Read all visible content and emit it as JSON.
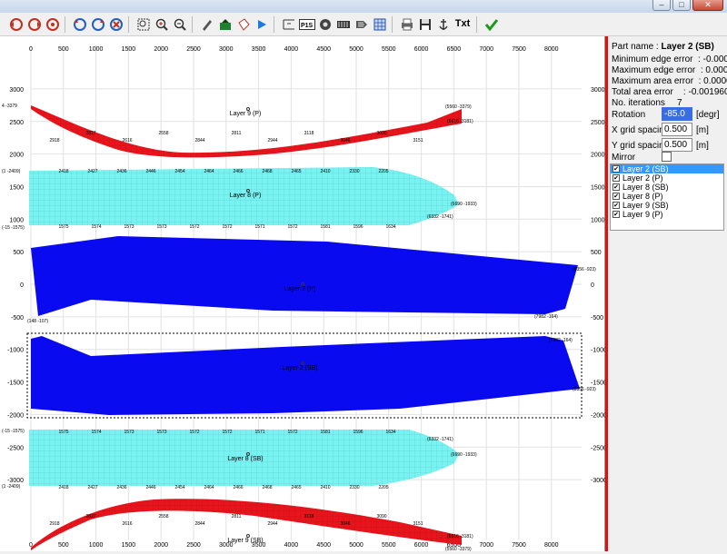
{
  "window": {
    "minimize": "–",
    "maximize": "□",
    "close": "✕"
  },
  "toolbar": {
    "icons": [
      "undo-icon",
      "redo-icon",
      "undo-all-icon",
      "redo-all-icon",
      "rotate-ccw-icon",
      "rotate-cw-icon",
      "rotate-reset-icon",
      "zoom-fit-icon",
      "zoom-in-icon",
      "zoom-out-icon",
      "draw-icon",
      "fill-icon",
      "tag-icon",
      "play-icon",
      "measure-icon",
      "p1s-icon",
      "wheel-icon",
      "film-icon",
      "stack-icon",
      "grid-icon",
      "print-icon",
      "save-icon",
      "anchor-icon",
      "text-icon",
      "ok-icon"
    ],
    "p1s_label": "P1S",
    "txt_label": "Txt"
  },
  "panel": {
    "part_name_label": "Part name",
    "part_name_value": "Layer 2 (SB)",
    "min_edge_label": "Minimum edge error",
    "min_edge_value": "-0.00023",
    "max_edge_label": "Maximum edge error",
    "max_edge_value": "0.00001",
    "max_area_label": "Maximum area error",
    "max_area_value": "0.000056",
    "total_area_label": "Total area error",
    "total_area_value": "-0.001960",
    "iterations_label": "No. iterations",
    "iterations_value": "7",
    "rotation_label": "Rotation",
    "rotation_value": "-85.0",
    "rotation_unit": "[degr]",
    "xgrid_label": "X grid spacing",
    "xgrid_value": "0.500",
    "xgrid_unit": "[m]",
    "ygrid_label": "Y grid spacing",
    "ygrid_value": "0.500",
    "ygrid_unit": "[m]",
    "mirror_label": "Mirror",
    "layers": [
      {
        "label": "Layer 2 (SB)",
        "checked": true,
        "active": true
      },
      {
        "label": "Layer 2 (P)",
        "checked": true,
        "active": false
      },
      {
        "label": "Layer 8 (SB)",
        "checked": true,
        "active": false
      },
      {
        "label": "Layer 8 (P)",
        "checked": true,
        "active": false
      },
      {
        "label": "Layer 9 (SB)",
        "checked": true,
        "active": false
      },
      {
        "label": "Layer 9 (P)",
        "checked": true,
        "active": false
      }
    ]
  },
  "plot": {
    "x_ticks": [
      "0",
      "500",
      "1000",
      "1500",
      "2000",
      "2500",
      "3000",
      "3500",
      "4000",
      "4500",
      "5000",
      "5500",
      "6000",
      "6500",
      "7000",
      "7500",
      "8000"
    ],
    "y_left_ticks": [
      "3000",
      "2500",
      "2000",
      "1500",
      "1000",
      "500",
      "0",
      "-500",
      "-1000",
      "-1500",
      "-2000",
      "-2500",
      "-3000"
    ],
    "y_right_ticks": [
      "3000",
      "2500",
      "2000",
      "1500",
      "1000",
      "500",
      "0",
      "-500",
      "-1000",
      "-1500",
      "-2000",
      "-2500",
      "-3000"
    ],
    "colors": {
      "red": "#e8141c",
      "cyan": "#79f2f2",
      "blue": "#0a0af0"
    },
    "parts": [
      {
        "label": "Layer 9 (P)"
      },
      {
        "label": "Layer 8 (P)"
      },
      {
        "label": "Layer 2 (P)"
      },
      {
        "label": "Layer 2 (SB)"
      },
      {
        "label": "Layer 8 (SB)"
      },
      {
        "label": "Layer 9 (SB)"
      }
    ],
    "top_bounds_labels": [
      "4 -3379",
      "(5560 -3379)",
      "(6616 -3181)",
      "2918",
      "2827",
      "2616",
      "2558",
      "2844",
      "2811",
      "2944",
      "3118",
      "3046",
      "3090",
      "3151"
    ],
    "cyan_labels_top": [
      "2418",
      "2427",
      "2436",
      "2446",
      "2454",
      "2464",
      "2466",
      "2468",
      "2465",
      "2410",
      "2330",
      "2205"
    ],
    "cyan_labels_bottom": [
      "1575",
      "1574",
      "1573",
      "1573",
      "1572",
      "1572",
      "1571",
      "1572",
      "1581",
      "1596",
      "1634"
    ],
    "cyan_corner_labels": [
      "(1 -2409)",
      "(-15 -1575)",
      "(6332 -1741)",
      "(6690 -1933)",
      "1634"
    ],
    "blue_top_corner": "(148 -107)",
    "blue_right_corner": "(7982 -164)",
    "blue_right_923": "(8356 -923)"
  }
}
